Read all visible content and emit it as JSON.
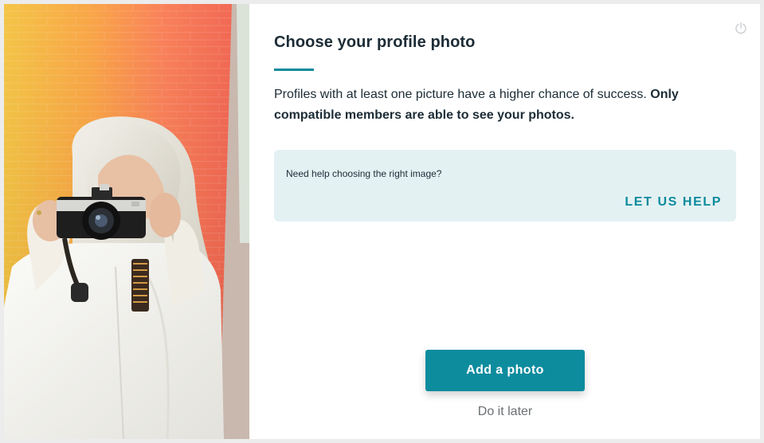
{
  "modal": {
    "title": "Choose your profile photo",
    "intro_text": "Profiles with at least one picture have a higher chance of success.",
    "intro_bold": "Only compatible members are able to see your photos.",
    "help_prompt": "Need help choosing the right image?",
    "help_link": "LET US HELP",
    "primary_button": "Add a photo",
    "secondary_link": "Do it later",
    "power_icon": "power-icon",
    "photo_description_icon": "profile-hero-photo"
  },
  "colors": {
    "accent": "#0b8a9c",
    "help_box_bg": "#e4f1f3",
    "title_text": "#1c2c36",
    "muted_text": "#6a6f73"
  }
}
